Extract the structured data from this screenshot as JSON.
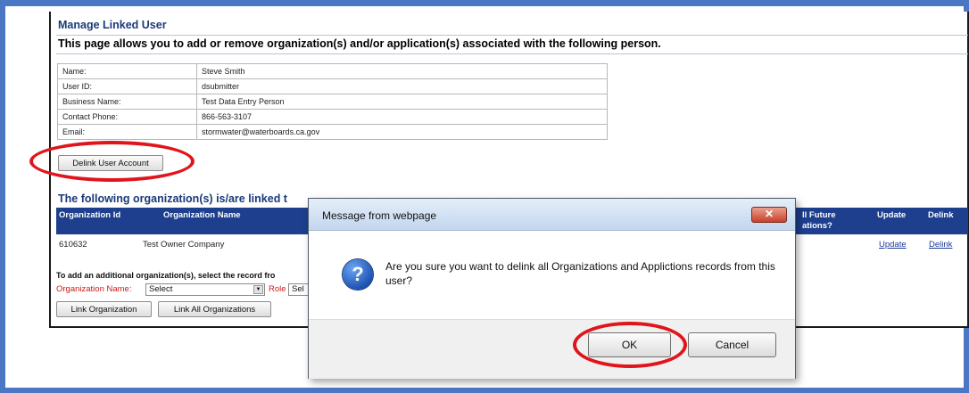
{
  "page": {
    "title": "Manage Linked User",
    "intro": "This page allows you to add or remove organization(s) and/or application(s) associated with the following person."
  },
  "person": [
    {
      "label": "Name:",
      "value": "Steve Smith"
    },
    {
      "label": "User ID:",
      "value": "dsubmitter"
    },
    {
      "label": "Business Name:",
      "value": "Test Data Entry Person"
    },
    {
      "label": "Contact Phone:",
      "value": "866-563-3107"
    },
    {
      "label": "Email:",
      "value": "stormwater@waterboards.ca.gov"
    }
  ],
  "delink_button": "Delink User Account",
  "org": {
    "heading": "The following organization(s) is/are linked t",
    "columns": {
      "id": "Organization Id",
      "name": "Organization Name",
      "future": "ll Future ations?",
      "update": "Update",
      "delink": "Delink"
    },
    "rows": [
      {
        "id": "610632",
        "name": "Test Owner Company",
        "update": "Update",
        "delink": "Delink"
      }
    ],
    "add_text": "To add an additional organization(s), select the record fro",
    "org_name_label": "Organization Name:",
    "org_select": "Select",
    "role_label": "Role",
    "role_select": "Sel",
    "link_button": "Link Organization",
    "link_all_button": "Link All Organizations"
  },
  "dialog": {
    "title": "Message from webpage",
    "message": "Are you sure you want to delink all Organizations and Applictions records from this user?",
    "ok": "OK",
    "cancel": "Cancel",
    "close_glyph": "✕",
    "icon_glyph": "?"
  },
  "colors": {
    "frame": "#4a76c4",
    "header_bar": "#1d3f8e",
    "highlight": "#e0151b"
  }
}
